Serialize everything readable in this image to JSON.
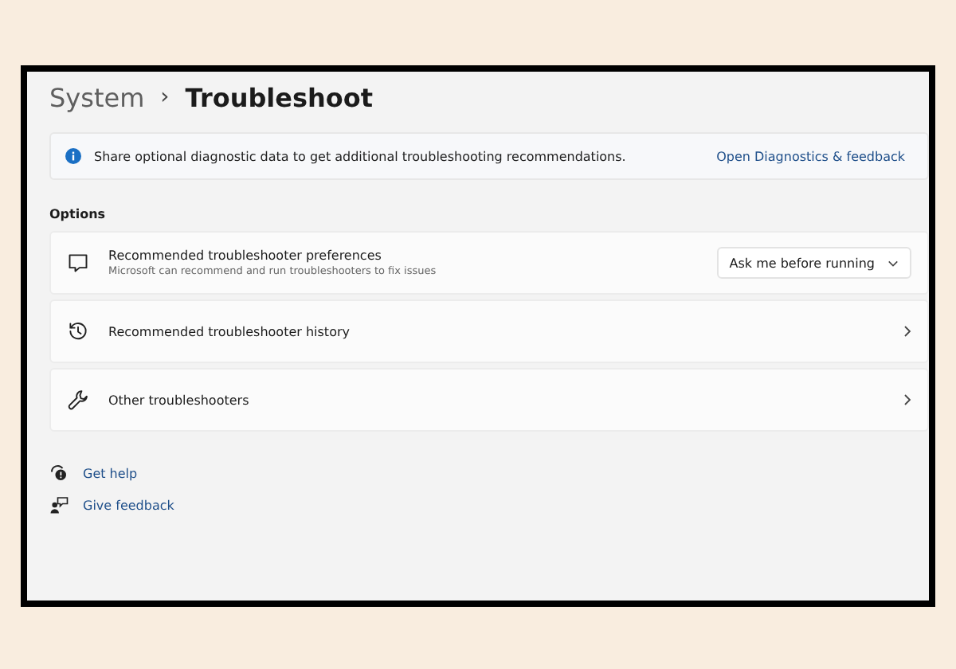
{
  "breadcrumb": {
    "parent": "System",
    "separator": "›",
    "current": "Troubleshoot"
  },
  "info_banner": {
    "text": "Share optional diagnostic data to get additional troubleshooting recommendations.",
    "link": "Open Diagnostics & feedback"
  },
  "section_title": "Options",
  "items": [
    {
      "kind": "dropdown",
      "title": "Recommended troubleshooter preferences",
      "description": "Microsoft can recommend and run troubleshooters to fix issues",
      "value": "Ask me before running"
    },
    {
      "kind": "link",
      "title": "Recommended troubleshooter history"
    },
    {
      "kind": "link",
      "title": "Other troubleshooters"
    }
  ],
  "footer_links": [
    "Get help",
    "Give feedback"
  ]
}
